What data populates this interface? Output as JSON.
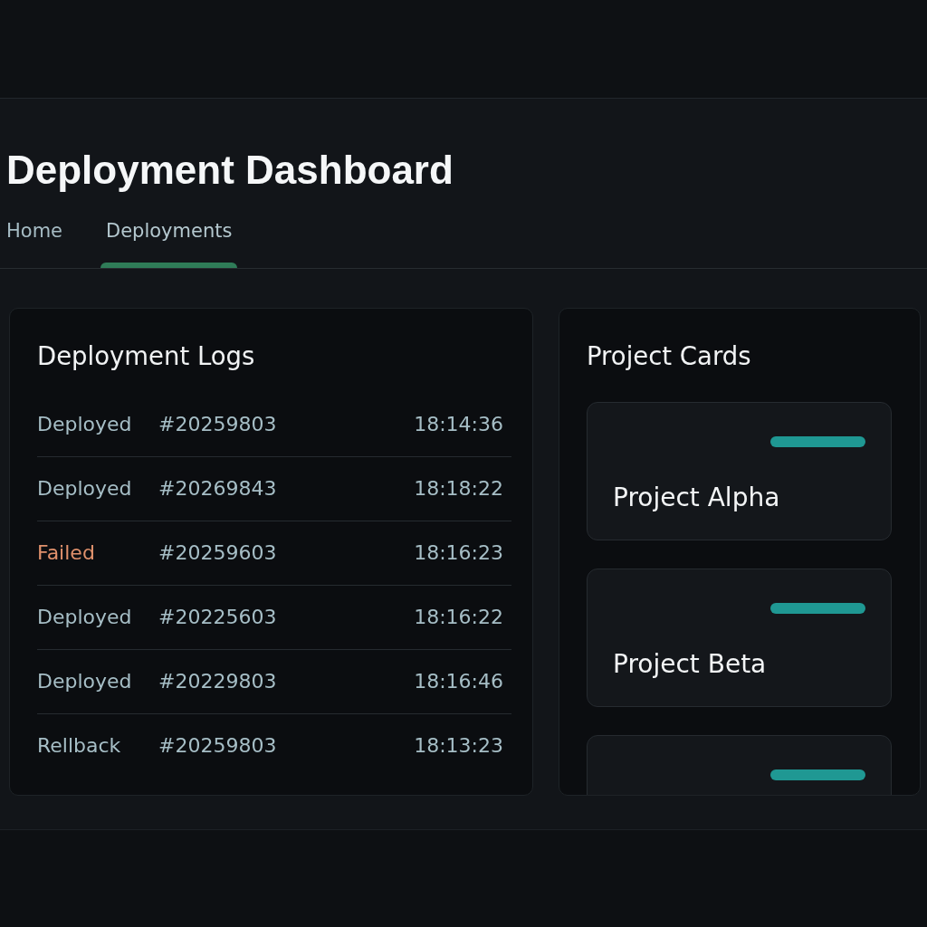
{
  "header": {
    "title": "Deployment Dashboard"
  },
  "tabs": [
    {
      "label": "Home",
      "selected": false
    },
    {
      "label": "Deployments",
      "selected": true
    }
  ],
  "deployment_logs": {
    "title": "Deployment Logs",
    "rows": [
      {
        "status": "Deployed",
        "kind": "normal",
        "build": "#20259803",
        "time": "18:14:36"
      },
      {
        "status": "Deployed",
        "kind": "normal",
        "build": "#20269843",
        "time": "18:18:22"
      },
      {
        "status": "Failed",
        "kind": "error",
        "build": "#20259603",
        "time": "18:16:23"
      },
      {
        "status": "Deployed",
        "kind": "normal",
        "build": "#20225603",
        "time": "18:16:22"
      },
      {
        "status": "Deployed",
        "kind": "normal",
        "build": "#20229803",
        "time": "18:16:46"
      },
      {
        "status": "Rellback",
        "kind": "normal",
        "build": "#20259803",
        "time": "18:13:23"
      }
    ]
  },
  "project_cards": {
    "title": "Project Cards",
    "cards": [
      {
        "kind": "project",
        "name": "Project Alpha"
      },
      {
        "kind": "project",
        "name": "Project Beta"
      },
      {
        "kind": "project"
      }
    ]
  }
}
